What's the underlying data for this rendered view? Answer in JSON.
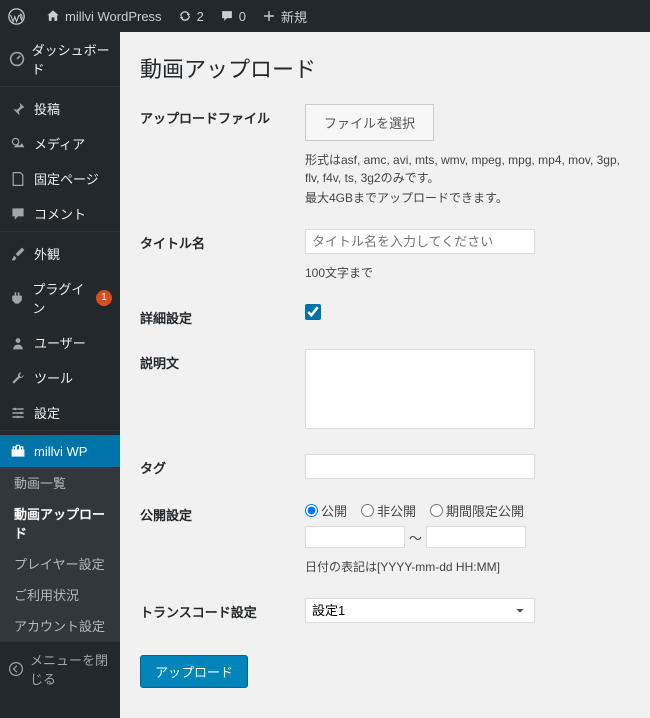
{
  "topbar": {
    "site_name": "millvi WordPress",
    "refresh_count": "2",
    "comment_count": "0",
    "new_label": "新規"
  },
  "sidebar": {
    "items": [
      {
        "label": "ダッシュボード"
      },
      {
        "label": "投稿"
      },
      {
        "label": "メディア"
      },
      {
        "label": "固定ページ"
      },
      {
        "label": "コメント"
      },
      {
        "label": "外観"
      },
      {
        "label": "プラグイン",
        "badge": "1"
      },
      {
        "label": "ユーザー"
      },
      {
        "label": "ツール"
      },
      {
        "label": "設定"
      },
      {
        "label": "millvi WP"
      }
    ],
    "submenu": [
      {
        "label": "動画一覧"
      },
      {
        "label": "動画アップロード"
      },
      {
        "label": "プレイヤー設定"
      },
      {
        "label": "ご利用状況"
      },
      {
        "label": "アカウント設定"
      }
    ],
    "collapse_label": "メニューを閉じる"
  },
  "page": {
    "title": "動画アップロード",
    "upload_file": {
      "label": "アップロードファイル",
      "button": "ファイルを選択",
      "hint1": "形式はasf, amc, avi, mts, wmv, mpeg, mpg, mp4, mov, 3gp, flv, f4v, ts, 3g2のみです。",
      "hint2": "最大4GBまでアップロードできます。"
    },
    "title_field": {
      "label": "タイトル名",
      "placeholder": "タイトル名を入力してください",
      "hint": "100文字まで"
    },
    "detail": {
      "label": "詳細設定",
      "checked": true
    },
    "description": {
      "label": "説明文"
    },
    "tag": {
      "label": "タグ"
    },
    "publish": {
      "label": "公開設定",
      "options": [
        "公開",
        "非公開",
        "期間限定公開"
      ],
      "selected": 0,
      "tilde": "〜",
      "date_hint": "日付の表記は[YYYY-mm-dd HH:MM]"
    },
    "transcode": {
      "label": "トランスコード設定",
      "options": [
        "設定1"
      ],
      "selected": "設定1"
    },
    "submit": "アップロード"
  }
}
